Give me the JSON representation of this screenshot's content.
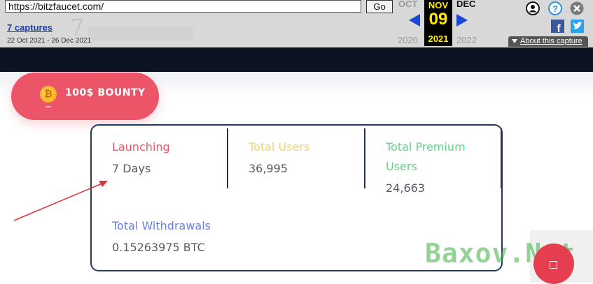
{
  "wayback": {
    "url": "https://bitzfaucet.com/",
    "go_label": "Go",
    "captures_label": "7 captures",
    "date_range": "22 Oct 2021 - 26 Dec 2021",
    "prev_month": "OCT",
    "current_month": "NOV",
    "current_day": "09",
    "next_month": "DEC",
    "prev_year": "2020",
    "current_year": "2021",
    "next_year": "2022",
    "about_label": "About this capture",
    "icons": [
      "user-icon",
      "help-icon",
      "close-icon",
      "facebook-icon",
      "twitter-icon"
    ]
  },
  "bounty": {
    "label": "100$ BOUNTY",
    "coin_symbol": "₿"
  },
  "stats": [
    {
      "label": "Launching",
      "value": "7 Days",
      "color": "#ec5467"
    },
    {
      "label": "Total Users",
      "value": "36,995",
      "color": "#f7d26a"
    },
    {
      "label": "Total Premium Users",
      "label_line1": "Total Premium",
      "label_line2": "Users",
      "value": "24,663",
      "color": "#5fd68a"
    },
    {
      "label": "Total Withdrawals",
      "value": "0.15263975 BTC",
      "color": "#6b7fe0"
    }
  ],
  "watermark": {
    "text": "Baxov.Net"
  },
  "colors": {
    "accent": "#ec5467",
    "navbar": "#0b1221",
    "card_border": "#223a5e",
    "wayback_bg": "#d8d8d8",
    "wayback_highlight": "#ffea00"
  }
}
